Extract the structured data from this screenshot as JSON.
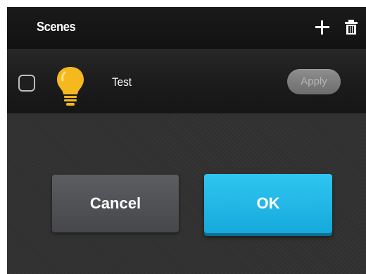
{
  "header": {
    "title": "Scenes",
    "add_icon": "plus-icon",
    "delete_icon": "trash-icon"
  },
  "scene": {
    "name": "Test",
    "icon": "lightbulb-icon",
    "icon_color": "#f5b81e",
    "checked": false,
    "apply_label": "Apply"
  },
  "dialog": {
    "cancel_label": "Cancel",
    "ok_label": "OK",
    "ok_color": "#1fb8e8"
  }
}
